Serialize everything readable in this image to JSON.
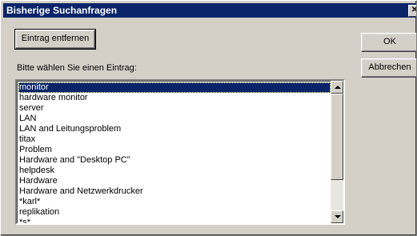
{
  "window": {
    "title": "Bisherige Suchanfragen",
    "close_glyph": "✕"
  },
  "buttons": {
    "remove_label": "Eintrag entfernen",
    "ok_label": "OK",
    "cancel_label": "Abbrechen"
  },
  "prompt": "Bitte wählen Sie einen Eintrag:",
  "list": {
    "selected_index": 0,
    "items": [
      "monitor",
      "hardware monitor",
      "server",
      "LAN",
      "LAN and Leitungsproblem",
      "titax",
      "Problem",
      "Hardware and \"Desktop PC\"",
      "helpdesk",
      "Hardware",
      "Hardware and Netzwerkdrucker",
      "*karl*",
      "replikation",
      "*s*"
    ]
  },
  "icons": {
    "close": "close-icon",
    "scroll_up": "arrow-up-icon",
    "scroll_down": "arrow-down-icon"
  },
  "colors": {
    "titlebar": "#0a246a",
    "dialog_face": "#d4d0c8",
    "selection": "#0a246a"
  }
}
